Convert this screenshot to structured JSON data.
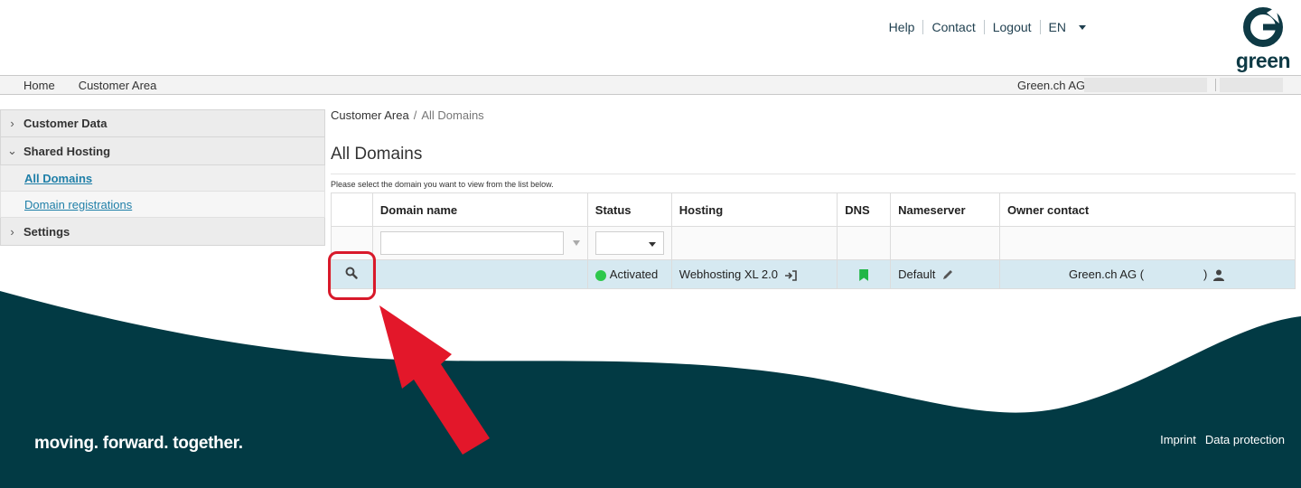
{
  "header": {
    "links": [
      "Help",
      "Contact",
      "Logout"
    ],
    "language": "EN",
    "logo_text": "green"
  },
  "navbar": {
    "items": [
      "Home",
      "Customer Area"
    ],
    "company": "Green.ch AG"
  },
  "sidebar": {
    "sections": [
      {
        "label": "Customer Data",
        "chevron": ">"
      },
      {
        "label": "Shared Hosting",
        "chevron": "v"
      },
      {
        "label": "Settings",
        "chevron": ">"
      }
    ],
    "subitems": [
      {
        "label": "All Domains",
        "active": true
      },
      {
        "label": "Domain registrations",
        "active": false
      }
    ]
  },
  "main": {
    "breadcrumb": [
      "Customer Area",
      "All Domains"
    ],
    "breadcrumb_sep": "/",
    "title": "All Domains",
    "hint": "Please select the domain you want to view from the list below.",
    "table": {
      "columns": [
        "Domain name",
        "Status",
        "Hosting",
        "DNS",
        "Nameserver",
        "Owner contact"
      ],
      "rows": [
        {
          "domain": "",
          "status": "Activated",
          "hosting": "Webhosting XL 2.0",
          "nameserver": "Default",
          "owner": "Green.ch AG (",
          "owner_end": ")"
        }
      ]
    }
  },
  "footer": {
    "tagline": "moving. forward. together.",
    "links": [
      "Imprint",
      "Data protection"
    ]
  },
  "colors": {
    "footer_bg": "#023a44",
    "active_row": "#d6e9f1",
    "status_green": "#2ec84c",
    "annotation_red": "#d8192a",
    "link_blue": "#1f7fa8"
  }
}
